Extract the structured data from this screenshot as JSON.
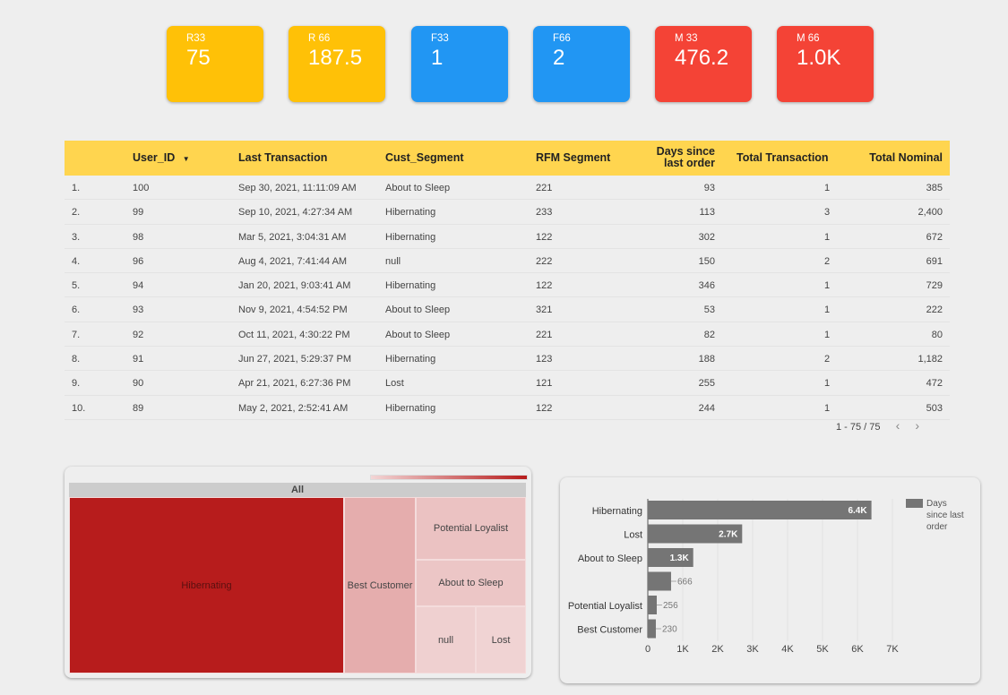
{
  "scorecards": [
    {
      "label": "R33",
      "value": "75",
      "color": "#ffc107"
    },
    {
      "label": "R 66",
      "value": "187.5",
      "color": "#ffc107"
    },
    {
      "label": "F33",
      "value": "1",
      "color": "#2196f3"
    },
    {
      "label": "F66",
      "value": "2",
      "color": "#2196f3"
    },
    {
      "label": "M 33",
      "value": "476.2",
      "color": "#f44336"
    },
    {
      "label": "M 66",
      "value": "1.0K",
      "color": "#f44336"
    }
  ],
  "table": {
    "header_color": "#ffd54f",
    "columns": [
      "User_ID",
      "Last Transaction",
      "Cust_Segment",
      "RFM Segment",
      "Days since",
      "last order",
      "Total Transaction",
      "Total Nominal"
    ],
    "sort_icon": "sort-desc-icon",
    "rows": [
      [
        "1.",
        "100",
        "Sep 30, 2021, 11:11:09 AM",
        "About to Sleep",
        "221",
        "93",
        "1",
        "385"
      ],
      [
        "2.",
        "99",
        "Sep 10, 2021, 4:27:34 AM",
        "Hibernating",
        "233",
        "113",
        "3",
        "2,400"
      ],
      [
        "3.",
        "98",
        "Mar 5, 2021, 3:04:31 AM",
        "Hibernating",
        "122",
        "302",
        "1",
        "672"
      ],
      [
        "4.",
        "96",
        "Aug 4, 2021, 7:41:44 AM",
        "null",
        "222",
        "150",
        "2",
        "691"
      ],
      [
        "5.",
        "94",
        "Jan 20, 2021, 9:03:41 AM",
        "Hibernating",
        "122",
        "346",
        "1",
        "729"
      ],
      [
        "6.",
        "93",
        "Nov 9, 2021, 4:54:52 PM",
        "About to Sleep",
        "321",
        "53",
        "1",
        "222"
      ],
      [
        "7.",
        "92",
        "Oct 11, 2021, 4:30:22 PM",
        "About to Sleep",
        "221",
        "82",
        "1",
        "80"
      ],
      [
        "8.",
        "91",
        "Jun 27, 2021, 5:29:37 PM",
        "Hibernating",
        "123",
        "188",
        "2",
        "1,182"
      ],
      [
        "9.",
        "90",
        "Apr 21, 2021, 6:27:36 PM",
        "Lost",
        "121",
        "255",
        "1",
        "472"
      ],
      [
        "10.",
        "89",
        "May 2, 2021, 2:52:41 AM",
        "Hibernating",
        "122",
        "244",
        "1",
        "503"
      ]
    ],
    "pagination": {
      "text": "1 - 75 / 75",
      "prev": "‹",
      "next": "›"
    }
  },
  "treemap": {
    "root_label": "All",
    "cells": [
      {
        "label": "Hibernating",
        "color": "#b71c1c"
      },
      {
        "label": "Best Customer",
        "color": "#e5adad"
      },
      {
        "label": "Potential Loyalist",
        "color": "#ebc2c2"
      },
      {
        "label": "About to Sleep",
        "color": "#ecc6c6"
      },
      {
        "label": "null",
        "color": "#efd0d0"
      },
      {
        "label": "Lost",
        "color": "#f0d3d3"
      }
    ]
  },
  "chart_data": {
    "type": "bar",
    "orientation": "horizontal",
    "categories": [
      "Hibernating",
      "Lost",
      "About to Sleep",
      "",
      "Potential Loyalist",
      "Best Customer"
    ],
    "series": [
      {
        "name": "Days since last order",
        "values": [
          6400,
          2700,
          1300,
          666,
          256,
          230
        ],
        "color": "#757575"
      }
    ],
    "data_labels": [
      "6.4K",
      "2.7K",
      "1.3K",
      "666",
      "256",
      "230"
    ],
    "x_ticks": [
      "0",
      "1K",
      "2K",
      "3K",
      "4K",
      "5K",
      "6K",
      "7K"
    ],
    "xlim": [
      0,
      7000
    ],
    "legend": {
      "label_lines": [
        "Days",
        "since last",
        "order"
      ],
      "position": "top-right"
    },
    "grid": true
  }
}
